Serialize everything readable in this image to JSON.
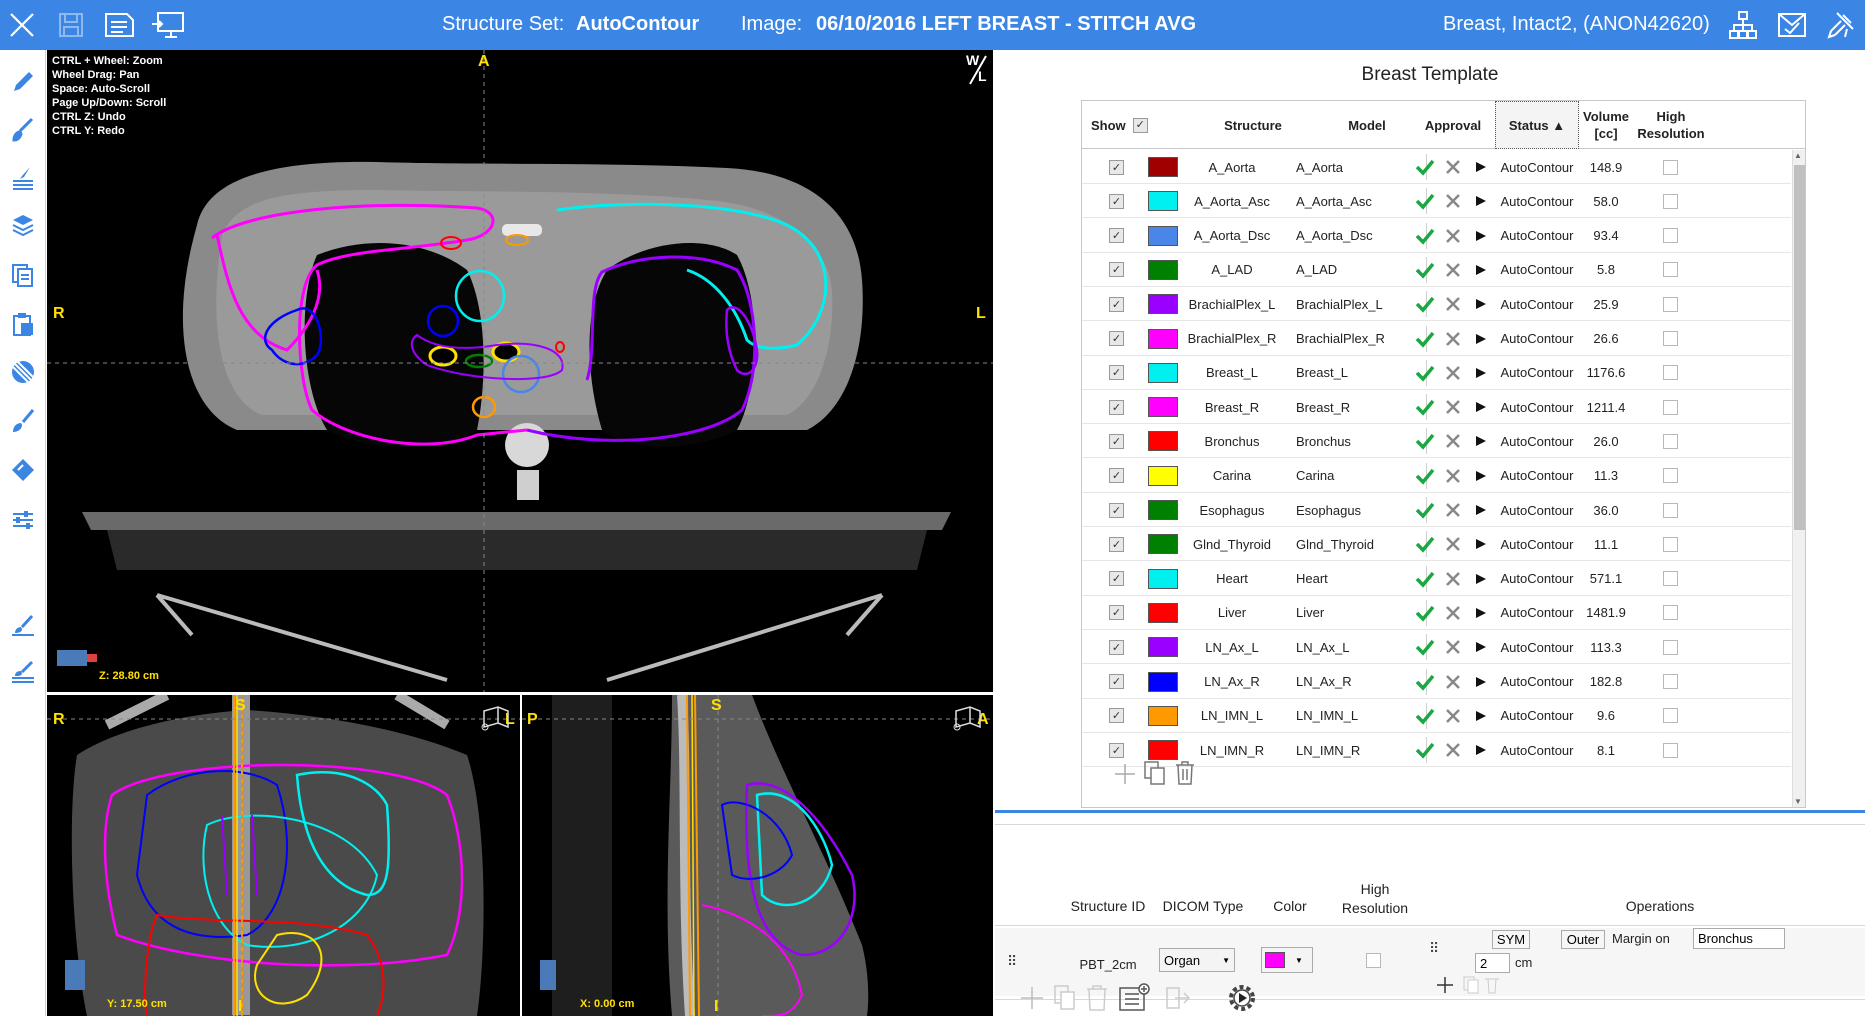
{
  "header": {
    "structure_set_label": "Structure Set:",
    "structure_set_value": "AutoContour",
    "image_label": "Image:",
    "image_value": "06/10/2016  LEFT BREAST - STITCH AVG",
    "patient": "Breast, Intact2,  (ANON42620)"
  },
  "axial": {
    "hints": [
      "CTRL + Wheel: Zoom",
      "Wheel Drag: Pan",
      "Space: Auto-Scroll",
      "Page Up/Down: Scroll",
      "CTRL Z: Undo",
      "CTRL Y: Redo"
    ],
    "top": "A",
    "left": "R",
    "right": "L",
    "position": "Z: 28.80 cm",
    "wl_top": "W",
    "wl_bottom": "L"
  },
  "coronal": {
    "top": "S",
    "left": "R",
    "right": "L",
    "bottom": "I",
    "position": "Y: 17.50 cm"
  },
  "sagittal": {
    "top": "S",
    "left": "P",
    "right": "A",
    "bottom": "I",
    "position": "X: 0.00 cm"
  },
  "template": {
    "title": "Breast Template",
    "columns": {
      "show": "Show",
      "structure": "Structure",
      "model": "Model",
      "approval": "Approval",
      "status": "Status ▲",
      "volume_line1": "Volume",
      "volume_line2": "[cc]",
      "hires_line1": "High",
      "hires_line2": "Resolution"
    },
    "rows": [
      {
        "structure": "A_Aorta",
        "model": "A_Aorta",
        "status": "AutoContour",
        "volume": "148.9",
        "color": "#a00000"
      },
      {
        "structure": "A_Aorta_Asc",
        "model": "A_Aorta_Asc",
        "status": "AutoContour",
        "volume": "58.0",
        "color": "#00f0f0"
      },
      {
        "structure": "A_Aorta_Dsc",
        "model": "A_Aorta_Dsc",
        "status": "AutoContour",
        "volume": "93.4",
        "color": "#4a86e8"
      },
      {
        "structure": "A_LAD",
        "model": "A_LAD",
        "status": "AutoContour",
        "volume": "5.8",
        "color": "#008000"
      },
      {
        "structure": "BrachialPlex_L",
        "model": "BrachialPlex_L",
        "status": "AutoContour",
        "volume": "25.9",
        "color": "#9a00ff"
      },
      {
        "structure": "BrachialPlex_R",
        "model": "BrachialPlex_R",
        "status": "AutoContour",
        "volume": "26.6",
        "color": "#ff00ff"
      },
      {
        "structure": "Breast_L",
        "model": "Breast_L",
        "status": "AutoContour",
        "volume": "1176.6",
        "color": "#00f0f0"
      },
      {
        "structure": "Breast_R",
        "model": "Breast_R",
        "status": "AutoContour",
        "volume": "1211.4",
        "color": "#ff00ff"
      },
      {
        "structure": "Bronchus",
        "model": "Bronchus",
        "status": "AutoContour",
        "volume": "26.0",
        "color": "#ff0000"
      },
      {
        "structure": "Carina",
        "model": "Carina",
        "status": "AutoContour",
        "volume": "11.3",
        "color": "#ffff00"
      },
      {
        "structure": "Esophagus",
        "model": "Esophagus",
        "status": "AutoContour",
        "volume": "36.0",
        "color": "#008000"
      },
      {
        "structure": "Glnd_Thyroid",
        "model": "Glnd_Thyroid",
        "status": "AutoContour",
        "volume": "11.1",
        "color": "#008000"
      },
      {
        "structure": "Heart",
        "model": "Heart",
        "status": "AutoContour",
        "volume": "571.1",
        "color": "#00f0f0"
      },
      {
        "structure": "Liver",
        "model": "Liver",
        "status": "AutoContour",
        "volume": "1481.9",
        "color": "#ff0000"
      },
      {
        "structure": "LN_Ax_L",
        "model": "LN_Ax_L",
        "status": "AutoContour",
        "volume": "113.3",
        "color": "#9a00ff"
      },
      {
        "structure": "LN_Ax_R",
        "model": "LN_Ax_R",
        "status": "AutoContour",
        "volume": "182.8",
        "color": "#0000ff"
      },
      {
        "structure": "LN_IMN_L",
        "model": "LN_IMN_L",
        "status": "AutoContour",
        "volume": "9.6",
        "color": "#ff9900"
      },
      {
        "structure": "LN_IMN_R",
        "model": "LN_IMN_R",
        "status": "AutoContour",
        "volume": "8.1",
        "color": "#ff0000"
      }
    ]
  },
  "editor": {
    "col_structure_id": "Structure ID",
    "col_dicom_type": "DICOM Type",
    "col_color": "Color",
    "col_hires_line1": "High",
    "col_hires_line2": "Resolution",
    "col_operations": "Operations",
    "structure_id": "PBT_2cm",
    "dicom_type": "Organ",
    "color": "#ff00ff",
    "sym_label": "SYM",
    "outer_label": "Outer",
    "margin_label": "Margin on",
    "margin_target": "Bronchus",
    "margin_value": "2",
    "margin_unit": "cm"
  }
}
